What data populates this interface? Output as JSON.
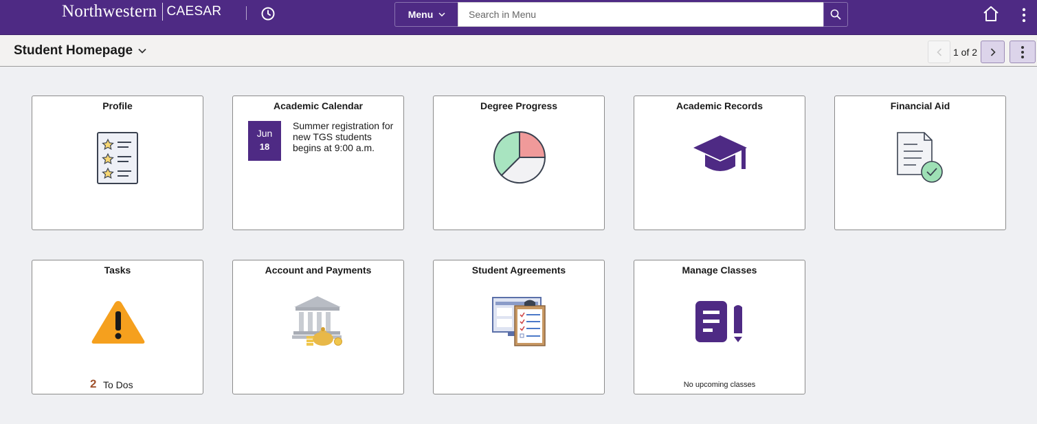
{
  "header": {
    "brand_primary": "Northwestern",
    "brand_secondary": "CAESAR",
    "menu_label": "Menu",
    "search_placeholder": "Search in Menu",
    "accent_color": "#4e2a84"
  },
  "subheader": {
    "page_title": "Student Homepage",
    "pager_text": "1 of 2"
  },
  "tiles": [
    {
      "title": "Profile",
      "icon": "profile-list-icon"
    },
    {
      "title": "Academic Calendar",
      "icon": "calendar-date-icon",
      "event_month": "Jun",
      "event_day": "18",
      "event_text": "Summer registration for new TGS students begins at 9:00 a.m."
    },
    {
      "title": "Degree Progress",
      "icon": "pie-chart-icon"
    },
    {
      "title": "Academic Records",
      "icon": "graduation-cap-icon"
    },
    {
      "title": "Financial Aid",
      "icon": "document-check-icon"
    },
    {
      "title": "Tasks",
      "icon": "warning-icon",
      "todo_count": "2",
      "todo_label": "To Dos"
    },
    {
      "title": "Account and Payments",
      "icon": "bank-money-icon"
    },
    {
      "title": "Student Agreements",
      "icon": "clipboard-checklist-icon"
    },
    {
      "title": "Manage Classes",
      "icon": "notepad-pencil-icon",
      "footer": "No upcoming classes"
    }
  ]
}
